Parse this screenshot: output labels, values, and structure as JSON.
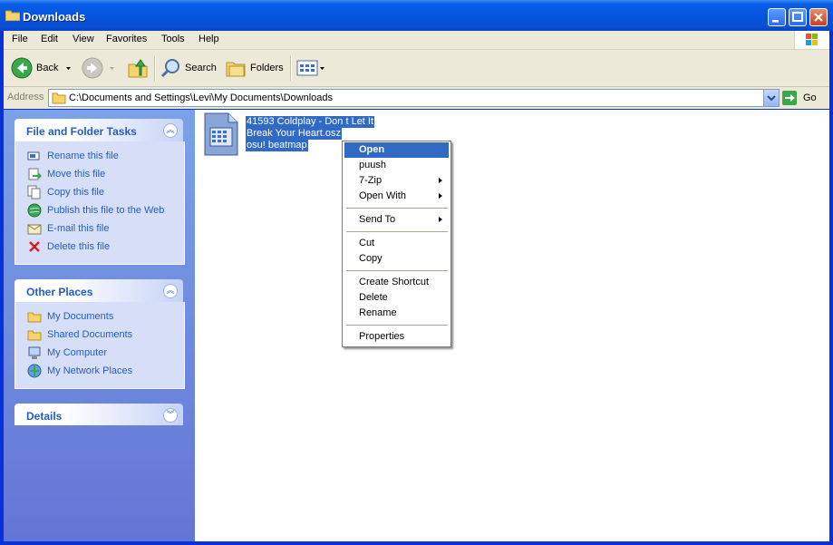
{
  "window": {
    "title": "Downloads"
  },
  "menu": [
    "File",
    "Edit",
    "View",
    "Favorites",
    "Tools",
    "Help"
  ],
  "toolbar": {
    "back": "Back",
    "search": "Search",
    "folders": "Folders"
  },
  "address": {
    "label": "Address",
    "path": "C:\\Documents and Settings\\Levi\\My Documents\\Downloads",
    "go": "Go"
  },
  "sidebar": {
    "file_tasks": {
      "title": "File and Folder Tasks",
      "items": [
        {
          "label": "Rename this file",
          "icon": "rename-icon"
        },
        {
          "label": "Move this file",
          "icon": "move-icon"
        },
        {
          "label": "Copy this file",
          "icon": "copy-icon"
        },
        {
          "label": "Publish this file to the Web",
          "icon": "web-icon"
        },
        {
          "label": "E-mail this file",
          "icon": "email-icon"
        },
        {
          "label": "Delete this file",
          "icon": "delete-icon"
        }
      ]
    },
    "other_places": {
      "title": "Other Places",
      "items": [
        {
          "label": "My Documents",
          "icon": "folder-icon"
        },
        {
          "label": "Shared Documents",
          "icon": "folder-icon"
        },
        {
          "label": "My Computer",
          "icon": "computer-icon"
        },
        {
          "label": "My Network Places",
          "icon": "network-icon"
        }
      ]
    },
    "details": {
      "title": "Details"
    }
  },
  "file": {
    "lines": [
      "41593 Coldplay - Don t Let It",
      "Break Your Heart.osz",
      "osu! beatmap"
    ]
  },
  "context_menu": {
    "items": [
      "Open",
      "puush",
      "7-Zip",
      "Open With",
      "Send To",
      "Cut",
      "Copy",
      "Create Shortcut",
      "Delete",
      "Rename",
      "Properties"
    ]
  }
}
